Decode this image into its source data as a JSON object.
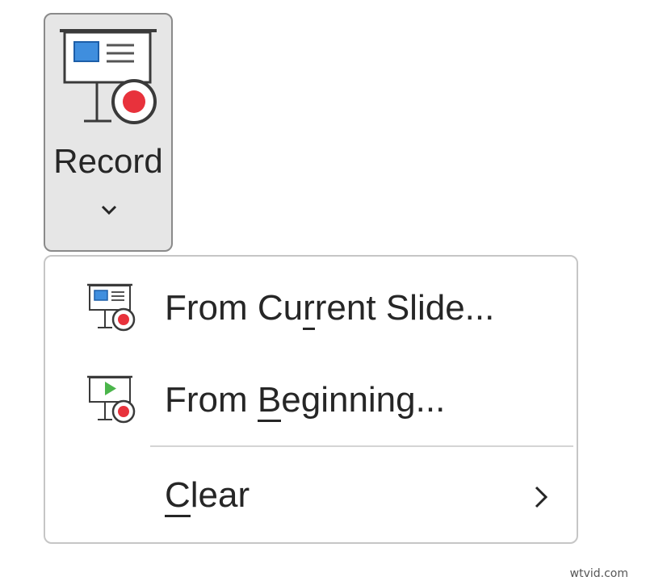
{
  "record_button": {
    "label": "Record",
    "icon": "screen-record-icon",
    "dropdown_icon": "chevron-down-icon"
  },
  "menu": {
    "items": [
      {
        "label_before": "From Cu",
        "mnemonic": "r",
        "label_after": "rent Slide...",
        "icon": "record-from-current-slide-icon"
      },
      {
        "label_before": "From ",
        "mnemonic": "B",
        "label_after": "eginning...",
        "icon": "record-from-beginning-icon"
      },
      {
        "label_before": "",
        "mnemonic": "C",
        "label_after": "lear",
        "icon": "",
        "submenu_icon": "chevron-right-icon"
      }
    ]
  },
  "colors": {
    "record_red": "#e8323c",
    "slide_blue": "#3f8ede",
    "play_green": "#4bb54b"
  },
  "watermark": "wtvid.com"
}
